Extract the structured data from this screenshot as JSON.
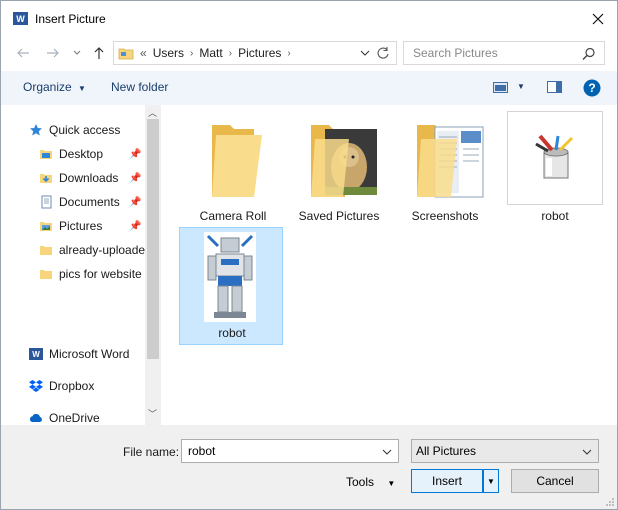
{
  "window": {
    "title": "Insert Picture",
    "close_icon": "close-icon"
  },
  "address": {
    "overflow": "«",
    "crumbs": [
      "Users",
      "Matt",
      "Pictures"
    ],
    "search_placeholder": "Search Pictures"
  },
  "toolbar": {
    "organize": "Organize",
    "new_folder": "New folder"
  },
  "nav": {
    "quick_access": "Quick access",
    "items": [
      {
        "label": "Desktop",
        "pinned": true
      },
      {
        "label": "Downloads",
        "pinned": true
      },
      {
        "label": "Documents",
        "pinned": true
      },
      {
        "label": "Pictures",
        "pinned": true
      },
      {
        "label": "already-uploade",
        "pinned": false
      },
      {
        "label": "pics for website",
        "pinned": false
      }
    ],
    "microsoft_word": "Microsoft Word",
    "dropbox": "Dropbox",
    "onedrive": "OneDrive"
  },
  "files": [
    {
      "name": "Camera Roll",
      "kind": "folder"
    },
    {
      "name": "Saved Pictures",
      "kind": "folder-photo"
    },
    {
      "name": "Screenshots",
      "kind": "folder-docs"
    },
    {
      "name": "robot",
      "kind": "image-paint"
    },
    {
      "name": "robot",
      "kind": "image-robot",
      "selected": true
    }
  ],
  "bottom": {
    "file_name_label": "File name:",
    "file_name_value": "robot",
    "filter": "All Pictures",
    "tools": "Tools",
    "insert": "Insert",
    "cancel": "Cancel"
  },
  "colors": {
    "accent": "#0078d7",
    "selection": "#cce8ff",
    "folder": "#f7d57c"
  }
}
